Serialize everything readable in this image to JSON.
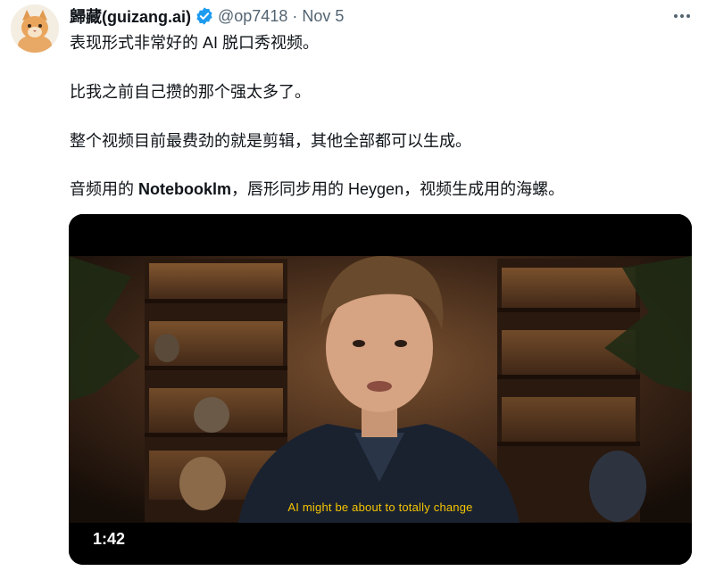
{
  "tweet": {
    "author_name": "歸藏(guizang.ai)",
    "handle": "@op7418",
    "separator": "·",
    "date": "Nov 5",
    "lines": [
      "表现形式非常好的 AI 脱口秀视频。",
      "比我之前自己攒的那个强太多了。",
      "整个视频目前最费劲的就是剪辑，其他全部都可以生成。"
    ],
    "line4_prefix": "音频用的 ",
    "line4_bold": "Notebooklm",
    "line4_suffix": "，唇形同步用的 Heygen，视频生成用的海螺。"
  },
  "video": {
    "subtitle": "AI might be about to totally change",
    "duration": "1:42"
  },
  "icons": {
    "avatar": "cat-avatar",
    "verified": "verified-badge-icon",
    "more": "more-options-icon"
  },
  "colors": {
    "verified_blue": "#1d9bf0",
    "subtitle_yellow": "#f5c400",
    "secondary_text": "#536471"
  }
}
